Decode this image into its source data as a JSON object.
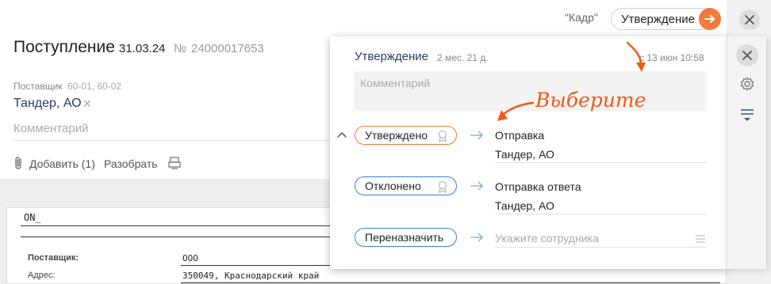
{
  "header": {
    "kadr_label": "\"Кадр\"",
    "stage_chip": "Утверждение"
  },
  "document": {
    "title": "Поступление",
    "date": "31.03.24",
    "number_label": "№",
    "number": "24000017653",
    "supplier_label": "Поставщик",
    "supplier_accounts": "60-01, 60-02",
    "supplier_value": "Тандер, АО",
    "comment_placeholder": "Комментарий",
    "add_label": "Добавить (1)",
    "parse_label": "Разобрать"
  },
  "sheet": {
    "header_text": "ON_",
    "rows": [
      {
        "label": "Поставщик:",
        "value": "ООО"
      },
      {
        "label": "Адрес:",
        "value": "350049, Краснодарский край"
      }
    ]
  },
  "popover": {
    "title": "Утверждение",
    "duration": "2 мес. 21 д.",
    "since": "с 13 июн 10:58",
    "comment_placeholder": "Комментарий",
    "hint": "Выберите",
    "actions": [
      {
        "label": "Утверждено",
        "target_line1": "Отправка",
        "target_line2": "Тандер, АО"
      },
      {
        "label": "Отклонено",
        "target_line1": "Отправка ответа",
        "target_line2": "Тандер, АО"
      },
      {
        "label": "Переназначить",
        "target_placeholder": "Укажите сотрудника"
      }
    ]
  },
  "colors": {
    "accent_orange": "#f27a3b",
    "accent_blue": "#3d7fd6",
    "title_blue": "#2a3a6a",
    "hint_orange": "#f05a16"
  },
  "icons": [
    "arrow-right-icon",
    "close-icon",
    "gear-icon",
    "filter-icon",
    "paperclip-icon",
    "scan-icon",
    "chevron-up-icon",
    "ribbon-icon",
    "list-icon"
  ]
}
